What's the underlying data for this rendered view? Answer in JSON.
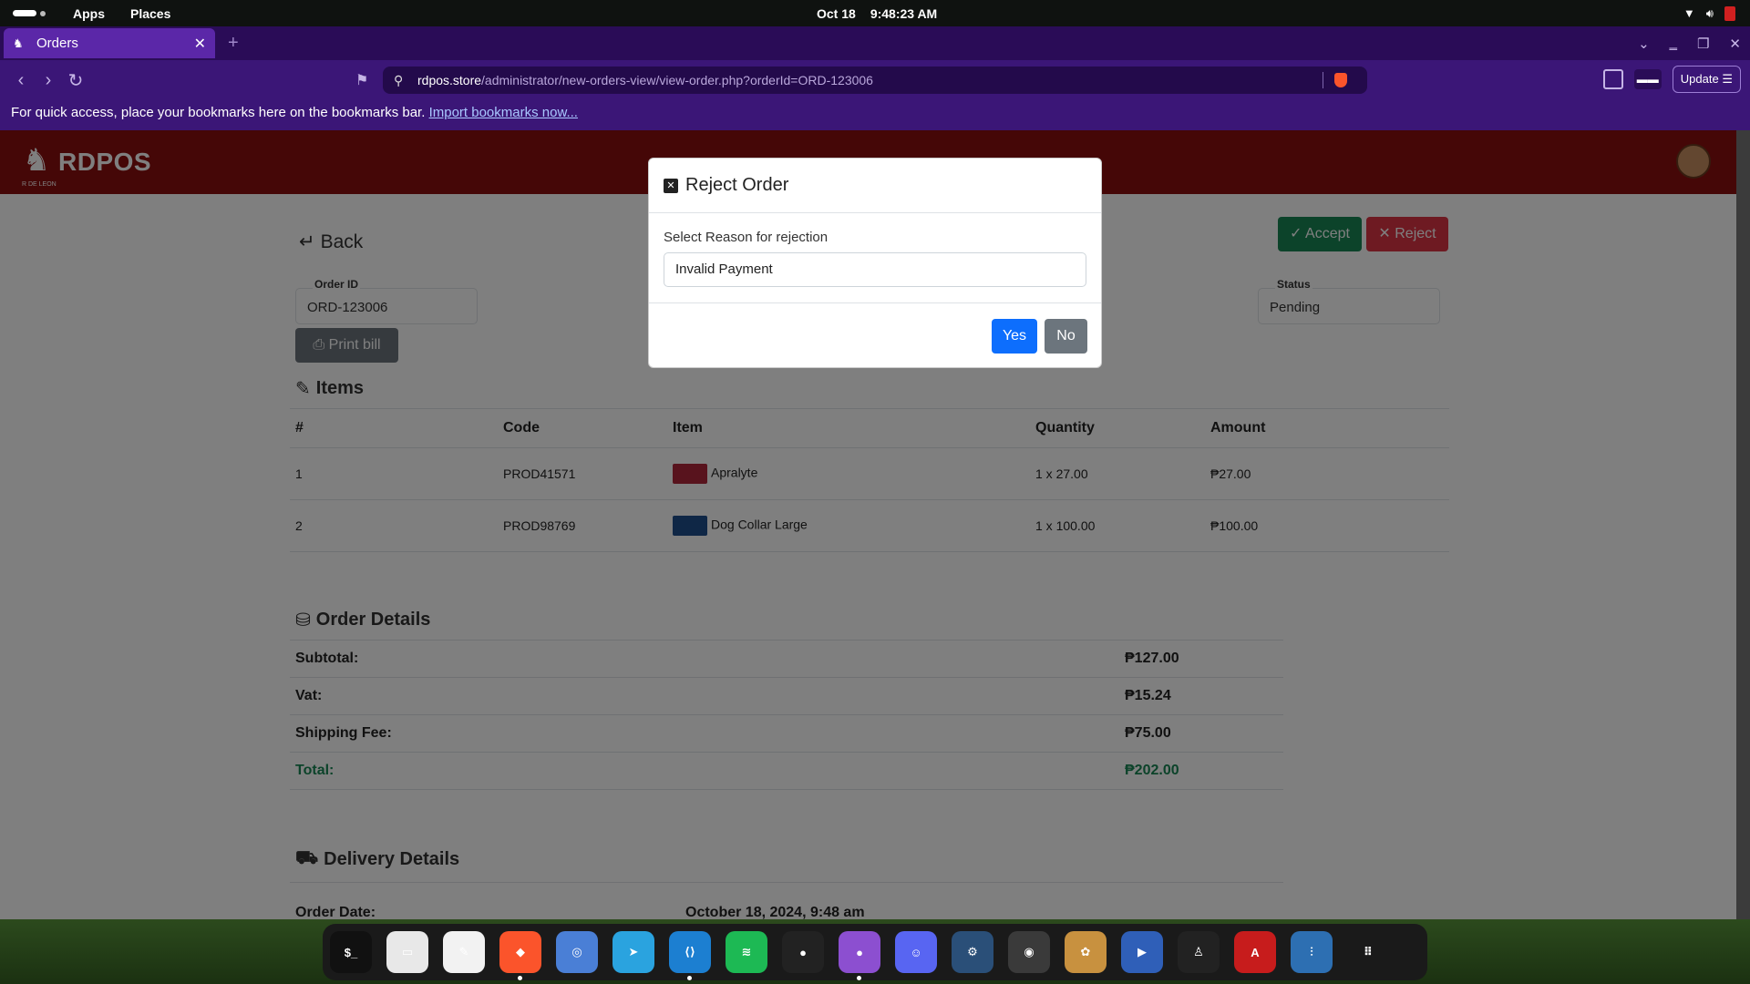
{
  "system": {
    "menu_apps": "Apps",
    "menu_places": "Places",
    "date": "Oct 18",
    "time": "9:48:23 AM"
  },
  "browser": {
    "tab_title": "Orders",
    "url_host": "rdpos.store",
    "url_path": "/administrator/new-orders-view/view-order.php?orderId=ORD-123006",
    "update_label": "Update",
    "bookmarks_text": "For quick access, place your bookmarks here on the bookmarks bar.",
    "bookmarks_link": "Import bookmarks now..."
  },
  "app": {
    "logo_text": "RDPOS",
    "logo_sub": "R DE LEON"
  },
  "order": {
    "back_label": "Back",
    "accept_label": "Accept",
    "reject_label": "Reject",
    "order_id_label": "Order ID",
    "order_id": "ORD-123006",
    "status_label": "Status",
    "status": "Pending",
    "print_label": "Print bill",
    "items_heading": "Items",
    "columns": [
      "#",
      "Code",
      "Item",
      "Quantity",
      "Amount"
    ],
    "items": [
      {
        "no": "1",
        "code": "PROD41571",
        "name": "Apralyte",
        "qty": "1 x 27.00",
        "amount": "₱27.00",
        "thumb_color": "#b0263a"
      },
      {
        "no": "2",
        "code": "PROD98769",
        "name": "Dog Collar Large",
        "qty": "1 x 100.00",
        "amount": "₱100.00",
        "thumb_color": "#1f4e8c"
      }
    ],
    "order_details_heading": "Order Details",
    "subtotal_label": "Subtotal:",
    "subtotal": "₱127.00",
    "vat_label": "Vat:",
    "vat": "₱15.24",
    "shipping_label": "Shipping Fee:",
    "shipping": "₱75.00",
    "total_label": "Total:",
    "total": "₱202.00",
    "delivery_heading": "Delivery Details",
    "order_date_label": "Order Date:",
    "order_date": "October 18, 2024, 9:48 am"
  },
  "modal": {
    "title": "Reject Order",
    "reason_label": "Select Reason for rejection",
    "reason_value": "Invalid Payment",
    "yes_label": "Yes",
    "no_label": "No"
  },
  "dock": [
    {
      "name": "terminal-icon",
      "glyph": "$_",
      "color": "#111111"
    },
    {
      "name": "files-icon",
      "glyph": "▭",
      "color": "#e8e8e8"
    },
    {
      "name": "text-editor-icon",
      "glyph": "✎",
      "color": "#f2f2f2"
    },
    {
      "name": "brave-icon",
      "glyph": "◆",
      "color": "#fb542b"
    },
    {
      "name": "chromium-icon",
      "glyph": "◎",
      "color": "#4a7fd6"
    },
    {
      "name": "telegram-icon",
      "glyph": "➤",
      "color": "#2aa3df"
    },
    {
      "name": "vscode-icon",
      "glyph": "⟨⟩",
      "color": "#1c7fd1"
    },
    {
      "name": "spotify-icon",
      "glyph": "≋",
      "color": "#1db954"
    },
    {
      "name": "github-icon",
      "glyph": "●",
      "color": "#222222"
    },
    {
      "name": "github-desktop-icon",
      "glyph": "●",
      "color": "#8c4fd0"
    },
    {
      "name": "discord-icon",
      "glyph": "☺",
      "color": "#5865f2"
    },
    {
      "name": "steam-icon",
      "glyph": "⚙",
      "color": "#2a4f78"
    },
    {
      "name": "obs-icon",
      "glyph": "◉",
      "color": "#3a3a3a"
    },
    {
      "name": "game-icon",
      "glyph": "✿",
      "color": "#c8913f"
    },
    {
      "name": "video-editor-icon",
      "glyph": "▶",
      "color": "#2f5fb8"
    },
    {
      "name": "inkscape-icon",
      "glyph": "♙",
      "color": "#222222"
    },
    {
      "name": "pdf-icon",
      "glyph": "A",
      "color": "#c71c1c"
    },
    {
      "name": "mixer-icon",
      "glyph": "⫶",
      "color": "#2d6fb2"
    },
    {
      "name": "app-grid-icon",
      "glyph": "⠿",
      "color": "#1a1a1a"
    }
  ]
}
